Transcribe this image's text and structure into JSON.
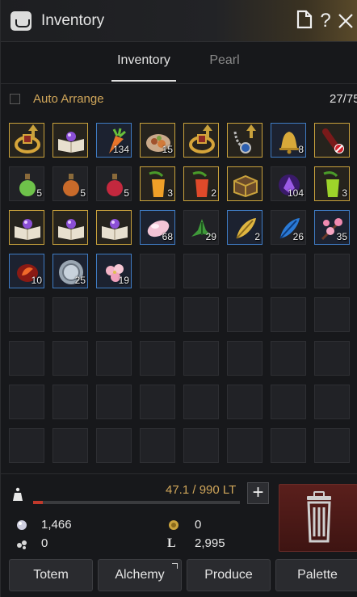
{
  "window": {
    "title": "Inventory",
    "title_icon": "inventory-bag-icon"
  },
  "title_buttons": [
    {
      "name": "note-icon",
      "label": "🗎"
    },
    {
      "name": "help-icon",
      "label": "?"
    },
    {
      "name": "close-icon",
      "label": "✕"
    }
  ],
  "tabs": {
    "active": "Inventory",
    "inactive": "Pearl"
  },
  "arrange": {
    "label": "Auto Arrange",
    "checked": false,
    "slots": "27/75"
  },
  "items": [
    {
      "name": "ring-gold",
      "quality": "gold",
      "icon": "ring-icon",
      "upgrade": true,
      "qty": ""
    },
    {
      "name": "book-purple",
      "quality": "gold",
      "icon": "book-icon",
      "upgrade": false,
      "qty": ""
    },
    {
      "name": "carrot",
      "quality": "blue",
      "icon": "carrot-icon",
      "upgrade": false,
      "qty": "134"
    },
    {
      "name": "meal-plate",
      "quality": "gold",
      "icon": "plate-icon",
      "upgrade": false,
      "qty": "15"
    },
    {
      "name": "ring-gold-2",
      "quality": "gold",
      "icon": "ring-icon",
      "upgrade": true,
      "qty": ""
    },
    {
      "name": "necklace",
      "quality": "gold",
      "icon": "necklace-icon",
      "upgrade": true,
      "qty": ""
    },
    {
      "name": "bell",
      "quality": "blue",
      "icon": "bell-icon",
      "upgrade": false,
      "qty": "8"
    },
    {
      "name": "dye-red",
      "quality": "gold",
      "icon": "dye-icon",
      "upgrade": false,
      "qty": ""
    },
    {
      "name": "potion-green",
      "quality": "none",
      "icon": "potion-green-icon",
      "upgrade": false,
      "qty": "5"
    },
    {
      "name": "potion-orange",
      "quality": "none",
      "icon": "potion-orange-icon",
      "upgrade": false,
      "qty": "5"
    },
    {
      "name": "potion-red",
      "quality": "none",
      "icon": "potion-red-icon",
      "upgrade": false,
      "qty": "5"
    },
    {
      "name": "juice-orange",
      "quality": "gold",
      "icon": "juice-orange-icon",
      "upgrade": false,
      "qty": "3"
    },
    {
      "name": "juice-red",
      "quality": "gold",
      "icon": "juice-red-icon",
      "upgrade": false,
      "qty": "2"
    },
    {
      "name": "chest",
      "quality": "gold",
      "icon": "chest-icon",
      "upgrade": false,
      "qty": ""
    },
    {
      "name": "crystal-purple",
      "quality": "none",
      "icon": "crystal-purple-icon",
      "upgrade": false,
      "qty": "104"
    },
    {
      "name": "juice-green",
      "quality": "gold",
      "icon": "juice-green-icon",
      "upgrade": false,
      "qty": "3"
    },
    {
      "name": "book-purple-2",
      "quality": "gold",
      "icon": "book-icon",
      "upgrade": false,
      "qty": ""
    },
    {
      "name": "book-purple-3",
      "quality": "gold",
      "icon": "book-icon",
      "upgrade": false,
      "qty": ""
    },
    {
      "name": "book-purple-4",
      "quality": "gold",
      "icon": "book-icon",
      "upgrade": false,
      "qty": ""
    },
    {
      "name": "petal-pink",
      "quality": "blue",
      "icon": "petal-icon",
      "upgrade": false,
      "qty": "68"
    },
    {
      "name": "herb-green",
      "quality": "none",
      "icon": "herb-icon",
      "upgrade": false,
      "qty": "29"
    },
    {
      "name": "feather-gold",
      "quality": "blue",
      "icon": "feather-icon",
      "upgrade": false,
      "qty": "2"
    },
    {
      "name": "feather-blue",
      "quality": "none",
      "icon": "feather-blue-icon",
      "upgrade": false,
      "qty": "26"
    },
    {
      "name": "blossom-branch",
      "quality": "blue",
      "icon": "blossom-icon",
      "upgrade": false,
      "qty": "35"
    },
    {
      "name": "fire-stone",
      "quality": "blue",
      "icon": "fire-stone-icon",
      "upgrade": false,
      "qty": "10"
    },
    {
      "name": "silver-coin",
      "quality": "blue",
      "icon": "coin-icon",
      "upgrade": false,
      "qty": "25"
    },
    {
      "name": "flower-pink",
      "quality": "blue",
      "icon": "flower-icon",
      "upgrade": false,
      "qty": "19"
    }
  ],
  "weight": {
    "text": "47.1 / 990 LT",
    "fraction": 0.048
  },
  "currency": {
    "silver": "1,466",
    "gold_coin": "0",
    "seeds": "0",
    "loyalty": "2,995"
  },
  "buttons": {
    "totem": "Totem",
    "alchemy": "Alchemy",
    "produce": "Produce",
    "palette": "Palette"
  },
  "colors": {
    "gold_quality": "#c9a23c",
    "blue_quality": "#3f7cc4",
    "accent_text": "#d0a65a",
    "trash": "#5a1f1c"
  }
}
